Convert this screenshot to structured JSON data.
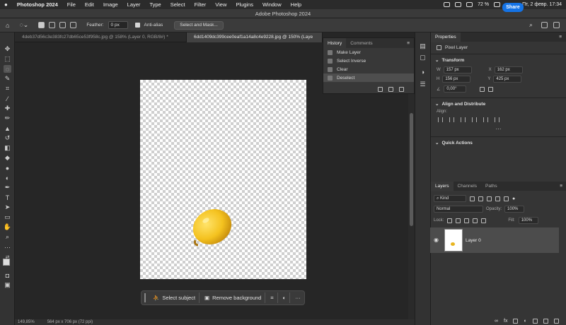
{
  "menubar": {
    "apple": "",
    "app": "Photoshop 2024",
    "items": [
      "File",
      "Edit",
      "Image",
      "Layer",
      "Type",
      "Select",
      "Filter",
      "View",
      "Plugins",
      "Window",
      "Help"
    ],
    "battery": "72 %",
    "datetime": "Пт, 2 февр.  17:34"
  },
  "titlebar": {
    "title": "Adobe Photoshop 2024"
  },
  "options": {
    "feather_label": "Feather:",
    "feather_value": "0 px",
    "antialias_label": "Anti-alias",
    "select_mask": "Select and Mask...",
    "share": "Share"
  },
  "tabs": [
    {
      "label": "4deb37d56c3e383fc27db65ce53f958c.jpg @ 158% (Layer 0, RGB/8#) *"
    },
    {
      "label": "6dd1409dc399cee0eaf1a14a8c4e9228.jpg @ 150% (Laye"
    }
  ],
  "history": {
    "tabs": [
      "History",
      "Comments"
    ],
    "items": [
      "Make Layer",
      "Select Inverse",
      "Clear",
      "Deselect"
    ]
  },
  "contextbar": {
    "select_subject": "Select subject",
    "remove_background": "Remove background",
    "more": "···"
  },
  "status": {
    "zoom": "149,85%",
    "docsize": "564 px x 706 px (72 ppi)"
  },
  "properties": {
    "title": "Properties",
    "kind": "Pixel Layer",
    "transform": {
      "label": "Transform",
      "w": "157 px",
      "x": "162 px",
      "h": "156 px",
      "y": "425 px",
      "angle": "0,00°"
    },
    "align": {
      "label": "Align and Distribute",
      "align_label": "Align:"
    },
    "quick_actions": "Quick Actions"
  },
  "layers": {
    "tabs": [
      "Layers",
      "Channels",
      "Paths"
    ],
    "kind": "Kind",
    "blend": "Normal",
    "opacity_label": "Opacity:",
    "opacity": "100%",
    "lock_label": "Lock:",
    "fill_label": "Fill:",
    "fill": "100%",
    "layer_name": "Layer 0"
  }
}
